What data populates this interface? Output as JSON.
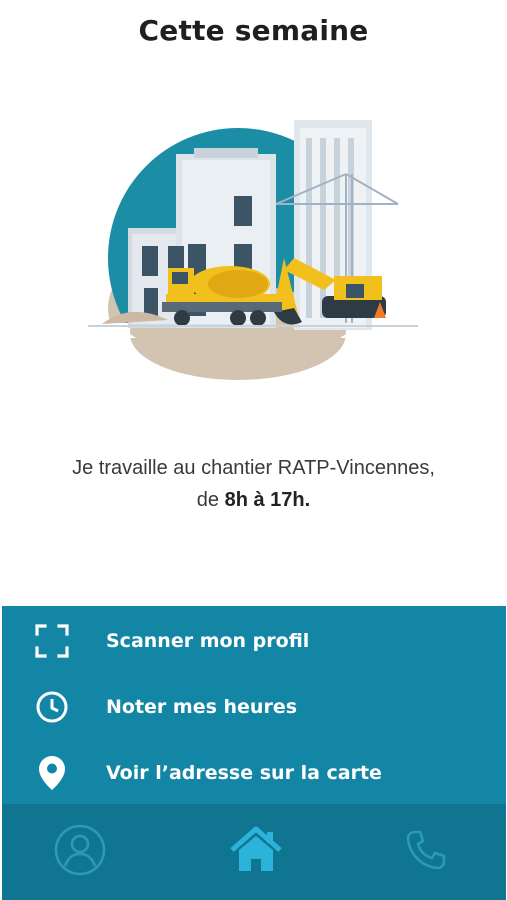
{
  "header": {
    "title": "Cette semaine"
  },
  "illustration": {
    "alt": "construction-site"
  },
  "description": {
    "line1": "Je travaille au chantier RATP-Vincennes,",
    "line2_prefix": "de ",
    "line2_hours": "8h à 17h."
  },
  "actions": [
    {
      "label": "Scanner mon profil",
      "icon": "scan-icon"
    },
    {
      "label": "Noter mes heures",
      "icon": "clock-icon"
    },
    {
      "label": "Voir l’adresse sur la carte",
      "icon": "map-pin-icon"
    }
  ],
  "tabbar": {
    "items": [
      {
        "icon": "profile-icon",
        "active": false
      },
      {
        "icon": "home-icon",
        "active": true
      },
      {
        "icon": "phone-icon",
        "active": false
      }
    ]
  },
  "colors": {
    "primary": "#1386a6",
    "tabbar": "#0f7591",
    "inactive_icon": "#2a9ab8",
    "active_icon": "#2bb3d9",
    "illustration_circle": "#1b8ea6",
    "machine_yellow": "#f2c01c"
  }
}
